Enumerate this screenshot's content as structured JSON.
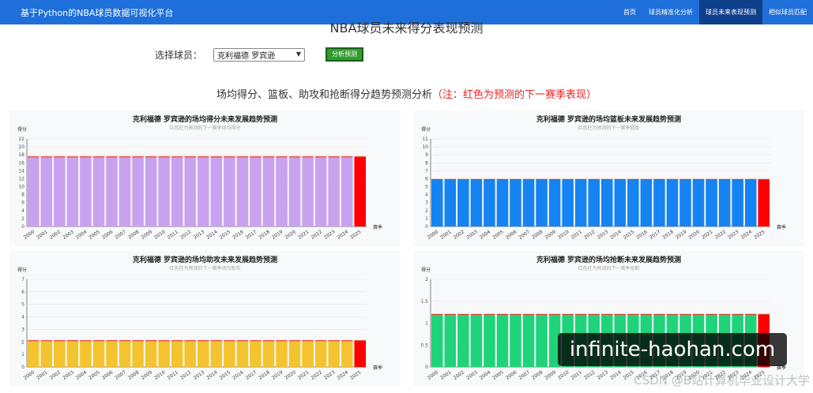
{
  "nav": {
    "brand": "基于Python的NBA球员数据可视化平台",
    "items": [
      {
        "label": "首页",
        "active": false
      },
      {
        "label": "球员精准化分析",
        "active": false
      },
      {
        "label": "球员未来表现预测",
        "active": true
      },
      {
        "label": "相似球员匹配",
        "active": false
      }
    ]
  },
  "page": {
    "title": "NBA球员未来得分表现预测",
    "select_label": "选择球员：",
    "select_value": "克利福德 罗宾逊",
    "button_label": "分析预测",
    "subtitle_main": "场均得分、篮板、助攻和抢断得分趋势预测分析",
    "subtitle_note": "（注：红色为预测的下一赛季表现）"
  },
  "colors": {
    "nav_bg": "#1e6fd9",
    "nav_active": "#0d3f8a",
    "prediction": "#ff0000",
    "marker_line": "#e8392c"
  },
  "watermark": {
    "text": "infinite-haohan.com",
    "csdn": "CSDN @B站计算机毕业设计大学"
  },
  "chart_data": [
    {
      "type": "bar",
      "title": "克利福德 罗宾逊的场均得分未来发展趋势预测",
      "subtitle": "红色柱为预测的下一赛季场均得分",
      "ylabel": "得分",
      "xlabel": "赛季",
      "ylim": [
        0,
        22
      ],
      "ytick_step": 2,
      "color": "#c9a2ef",
      "categories": [
        "2000",
        "2001",
        "2002",
        "2003",
        "2004",
        "2005",
        "2006",
        "2007",
        "2008",
        "2009",
        "2010",
        "2011",
        "2012",
        "2013",
        "2014",
        "2015",
        "2016",
        "2017",
        "2018",
        "2019",
        "2020",
        "2021",
        "2022",
        "2023",
        "2024",
        "2025"
      ],
      "values": [
        17.5,
        17.5,
        17.5,
        17.5,
        17.5,
        17.5,
        17.5,
        17.5,
        17.5,
        17.5,
        17.5,
        17.5,
        17.5,
        17.5,
        17.5,
        17.5,
        17.5,
        17.5,
        17.5,
        17.5,
        17.5,
        17.5,
        17.5,
        17.5,
        17.5,
        17.5
      ],
      "predicted_category": "2025"
    },
    {
      "type": "bar",
      "title": "克利福德 罗宾逊的场均篮板未来发展趋势预测",
      "subtitle": "红色柱为预测的下一赛季篮板",
      "ylabel": "得分",
      "xlabel": "赛季",
      "ylim": [
        0,
        11
      ],
      "ytick_step": 1,
      "color": "#1683f2",
      "categories": [
        "2000",
        "2001",
        "2002",
        "2003",
        "2004",
        "2005",
        "2006",
        "2007",
        "2008",
        "2009",
        "2010",
        "2011",
        "2012",
        "2013",
        "2014",
        "2015",
        "2016",
        "2017",
        "2018",
        "2019",
        "2020",
        "2021",
        "2022",
        "2023",
        "2024",
        "2025"
      ],
      "values": [
        5.9,
        5.9,
        5.9,
        5.9,
        5.9,
        5.9,
        5.9,
        5.9,
        5.9,
        5.9,
        5.9,
        5.9,
        5.9,
        5.9,
        5.9,
        5.9,
        5.9,
        5.9,
        5.9,
        5.9,
        5.9,
        5.9,
        5.9,
        5.9,
        5.9,
        5.9
      ],
      "predicted_category": "2025"
    },
    {
      "type": "bar",
      "title": "克利福德 罗宾逊的场均助攻未来发展趋势预测",
      "subtitle": "红色柱为预测的下一赛季场均助攻",
      "ylabel": "得分",
      "xlabel": "赛季",
      "ylim": [
        0,
        7
      ],
      "ytick_step": 1,
      "color": "#f4c430",
      "categories": [
        "2000",
        "2001",
        "2002",
        "2003",
        "2004",
        "2005",
        "2006",
        "2007",
        "2008",
        "2009",
        "2010",
        "2011",
        "2012",
        "2013",
        "2014",
        "2015",
        "2016",
        "2017",
        "2018",
        "2019",
        "2020",
        "2021",
        "2022",
        "2023",
        "2024",
        "2025"
      ],
      "values": [
        2.1,
        2.1,
        2.1,
        2.1,
        2.1,
        2.1,
        2.1,
        2.1,
        2.1,
        2.1,
        2.1,
        2.1,
        2.1,
        2.1,
        2.1,
        2.1,
        2.1,
        2.1,
        2.1,
        2.1,
        2.1,
        2.1,
        2.1,
        2.1,
        2.1,
        2.1
      ],
      "predicted_category": "2025"
    },
    {
      "type": "bar",
      "title": "克利福德 罗宾逊的场均抢断未来发展趋势预测",
      "subtitle": "红色柱为预测的下一赛季抢断",
      "ylabel": "得分",
      "xlabel": "赛季",
      "ylim": [
        0,
        2
      ],
      "ytick_step": 0.5,
      "color": "#1fd37a",
      "categories": [
        "2000",
        "2001",
        "2002",
        "2003",
        "2004",
        "2005",
        "2006",
        "2007",
        "2008",
        "2009",
        "2010",
        "2011",
        "2012",
        "2013",
        "2014",
        "2015",
        "2016",
        "2017",
        "2018",
        "2019",
        "2020",
        "2021",
        "2022",
        "2023",
        "2024",
        "2025"
      ],
      "values": [
        1.2,
        1.2,
        1.2,
        1.2,
        1.2,
        1.2,
        1.2,
        1.2,
        1.2,
        1.2,
        1.2,
        1.2,
        1.2,
        1.2,
        1.2,
        1.2,
        1.2,
        1.2,
        1.2,
        1.2,
        1.2,
        1.2,
        1.2,
        1.2,
        1.2,
        1.2
      ],
      "predicted_category": "2025"
    }
  ]
}
